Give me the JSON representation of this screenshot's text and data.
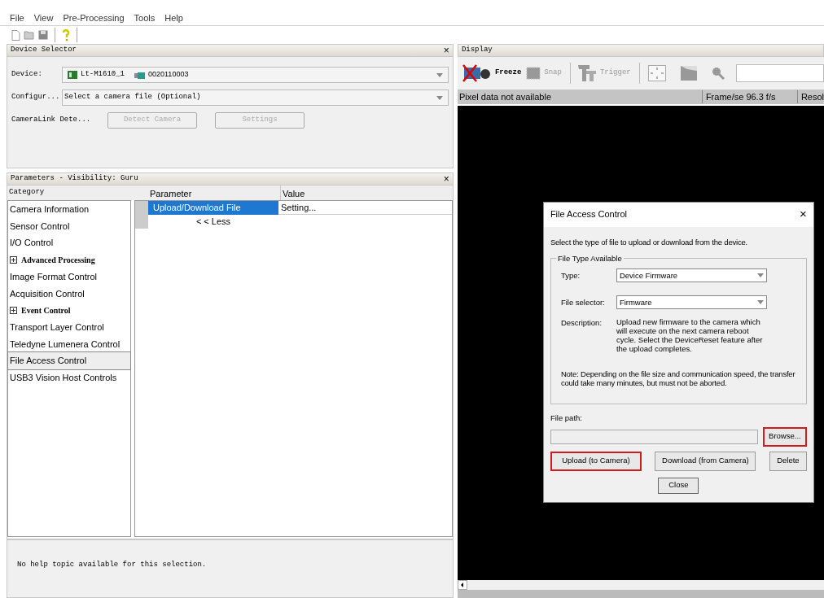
{
  "menu": [
    "File",
    "View",
    "Pre-Processing",
    "Tools",
    "Help"
  ],
  "device_selector": {
    "title": "Device Selector",
    "close": "×",
    "device_label": "Device:",
    "device_name": "Lt-M1610_1",
    "device_serial": "0020110003",
    "config_label": "Configur...",
    "config_placeholder": "Select a camera file (Optional)",
    "cameralink_label": "CameraLink Dete...",
    "buttons": [
      {
        "label": "Detect Camera",
        "disabled": true
      },
      {
        "label": "Settings",
        "disabled": true
      }
    ]
  },
  "parameters": {
    "title": "Parameters - Visibility: Guru",
    "close": "×",
    "columns": [
      "Category",
      "Parameter",
      "Value"
    ],
    "categories": [
      {
        "label": "Camera Information",
        "kind": "item",
        "selected": false
      },
      {
        "label": "Sensor Control",
        "kind": "item",
        "selected": false
      },
      {
        "label": "I/O Control",
        "kind": "item",
        "selected": false
      },
      {
        "label": "Advanced Processing",
        "kind": "group",
        "selected": false
      },
      {
        "label": "Image Format Control",
        "kind": "item",
        "selected": false
      },
      {
        "label": "Acquisition Control",
        "kind": "item",
        "selected": false
      },
      {
        "label": "Event Control",
        "kind": "group",
        "selected": false
      },
      {
        "label": "Transport Layer Control",
        "kind": "item",
        "selected": false
      },
      {
        "label": "Teledyne Lumenera Control",
        "kind": "item",
        "selected": false
      },
      {
        "label": "File Access Control",
        "kind": "item",
        "selected": true
      },
      {
        "label": "USB3 Vision Host Controls",
        "kind": "item",
        "selected": false
      }
    ],
    "rows": [
      {
        "parameter": "Upload/Download File",
        "value": "Setting...",
        "selected": true
      }
    ],
    "less": "< < Less",
    "help": "No help topic available for this selection."
  },
  "display": {
    "title": "Display",
    "toolbar": [
      {
        "label": "Freeze",
        "disabled": false
      },
      {
        "label": "Snap",
        "disabled": true
      },
      {
        "label": "Trigger",
        "disabled": true
      }
    ],
    "status": [
      "Pixel data not available",
      "Frame/se 96.3 f/s",
      "Resol"
    ]
  },
  "dialog": {
    "title": "File Access Control",
    "close": "×",
    "intro": "Select the type of file to upload or download from the device.",
    "group_title": "File Type Available",
    "type_label": "Type:",
    "type_value": "Device Firmware",
    "selector_label": "File selector:",
    "selector_value": "Firmware",
    "description_label": "Description:",
    "description": "Upload new firmware to the camera which will execute on the next camera reboot cycle. Select the DeviceReset feature after the upload completes.",
    "note": "Note: Depending on the file size and communication speed, the transfer could take many minutes, but must not be aborted.",
    "path_label": "File path:",
    "browse": {
      "label": "Browse...",
      "highlighted": true
    },
    "actions": [
      {
        "label": "Upload (to Camera)",
        "highlighted": true
      },
      {
        "label": "Download (from Camera)",
        "highlighted": false
      },
      {
        "label": "Delete",
        "highlighted": false
      }
    ],
    "close_button": "Close"
  }
}
